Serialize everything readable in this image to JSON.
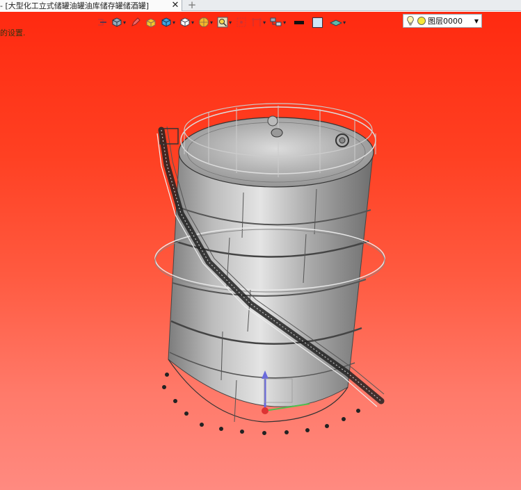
{
  "tab": {
    "title": "- [大型化工立式储罐油罐油库储存罐储酒罐]",
    "close_symbol": "✕",
    "new_tab_symbol": "+"
  },
  "viewport": {
    "hint_text": "的设置."
  },
  "toolbar": {
    "buttons": [
      "exit-sketch-icon",
      "view-cube-icon",
      "pen-icon",
      "box-yellow-icon",
      "box-blue-icon",
      "box-white-icon",
      "render-sphere-icon",
      "zoom-icon",
      "section-icon",
      "frame-icon",
      "layers-stack-icon",
      "line-color-swatch",
      "fill-color-swatch",
      "plane-icon"
    ],
    "line_color": "#111111",
    "fill_color": "#cfe6f5"
  },
  "layer": {
    "label": "图层0000"
  },
  "colors": {
    "background_top": "#ff2a10",
    "background_bottom": "#ff8a80"
  }
}
